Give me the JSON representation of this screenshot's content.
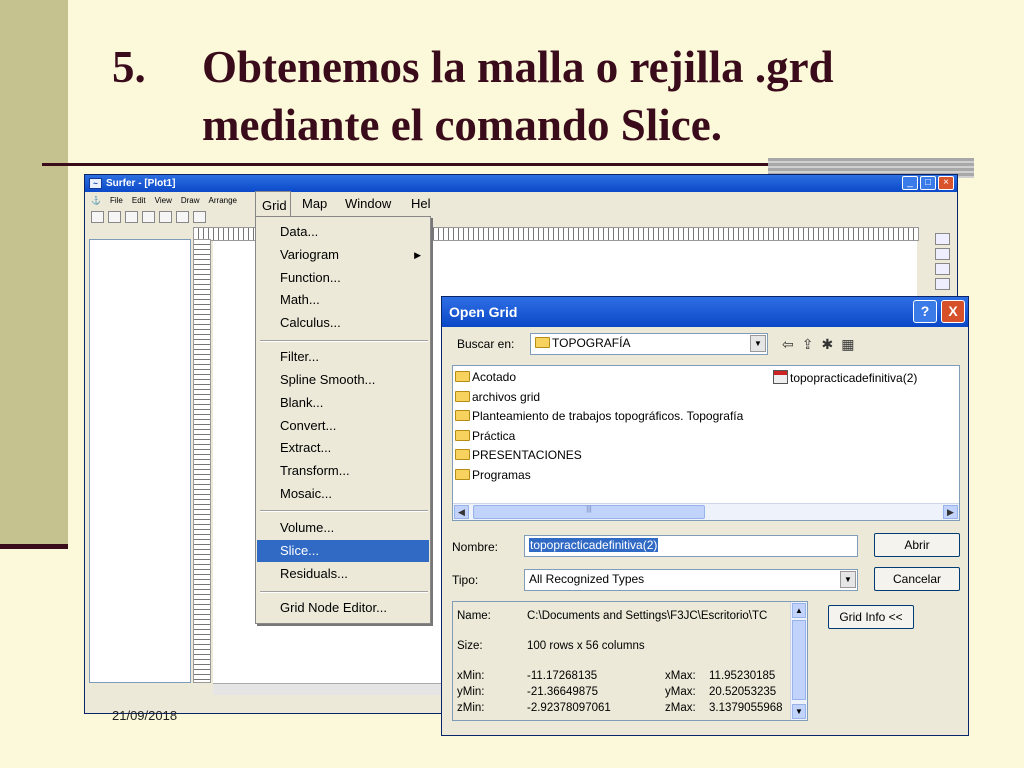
{
  "slide": {
    "number": "5.",
    "title": "Obtenemos la malla o rejilla .grd mediante el comando Slice.",
    "date": "21/09/2018"
  },
  "surfer": {
    "title": "Surfer - [Plot1]",
    "menubar": [
      "File",
      "Edit",
      "View",
      "Draw",
      "Arrange"
    ],
    "top_menus": [
      "Grid",
      "Map",
      "Window",
      "Hel"
    ]
  },
  "grid_menu": {
    "items": [
      {
        "label": "Data...",
        "submenu": false
      },
      {
        "label": "Variogram",
        "submenu": true
      },
      {
        "label": "Function...",
        "submenu": false
      },
      {
        "label": "Math...",
        "submenu": false
      },
      {
        "label": "Calculus...",
        "submenu": false
      },
      {
        "label": "Filter...",
        "submenu": false
      },
      {
        "label": "Spline Smooth...",
        "submenu": false
      },
      {
        "label": "Blank...",
        "submenu": false
      },
      {
        "label": "Convert...",
        "submenu": false
      },
      {
        "label": "Extract...",
        "submenu": false
      },
      {
        "label": "Transform...",
        "submenu": false
      },
      {
        "label": "Mosaic...",
        "submenu": false
      },
      {
        "label": "Volume...",
        "submenu": false
      },
      {
        "label": "Slice...",
        "submenu": false,
        "selected": true
      },
      {
        "label": "Residuals...",
        "submenu": false
      },
      {
        "label": "Grid Node Editor...",
        "submenu": false
      }
    ]
  },
  "open_grid": {
    "title": "Open Grid",
    "help": "?",
    "close": "X",
    "look_in_label": "Buscar en:",
    "look_in_value": "TOPOGRAFÍA",
    "folders": [
      "Acotado",
      "archivos grid",
      "Planteamiento de trabajos topográficos. Topografía",
      "Práctica",
      "PRESENTACIONES",
      "Programas"
    ],
    "file": "topopracticadefinitiva(2)",
    "name_label": "Nombre:",
    "name_value": "topopracticadefinitiva(2)",
    "type_label": "Tipo:",
    "type_value": "All Recognized Types",
    "open_button": "Abrir",
    "cancel_button": "Cancelar",
    "info_button": "Grid Info <<",
    "info": {
      "name_label": "Name:",
      "name_value": "C:\\Documents and Settings\\F3JC\\Escritorio\\TC",
      "size_label": "Size:",
      "size_value": "100 rows x 56 columns",
      "xmin_label": "xMin:",
      "xmin_value": "-11.17268135",
      "xmax_label": "xMax:",
      "xmax_value": "11.95230185",
      "ymin_label": "yMin:",
      "ymin_value": "-21.36649875",
      "ymax_label": "yMax:",
      "ymax_value": "20.52053235",
      "zmin_label": "zMin:",
      "zmin_value": "-2.92378097061",
      "zmax_label": "zMax:",
      "zmax_value": "3.1379055968"
    }
  },
  "colors": {
    "slide_bg": "#fbf9d9",
    "title_color": "#3a0b1a",
    "band": "#c6c28f",
    "selection": "#316ac5"
  }
}
